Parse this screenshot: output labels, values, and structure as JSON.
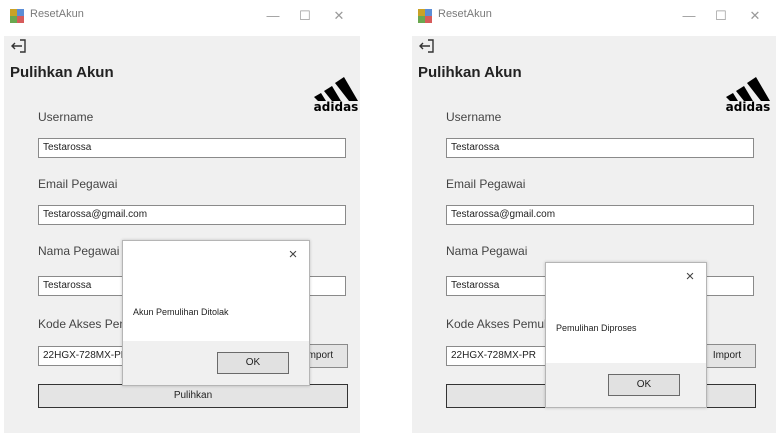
{
  "window_title": "ResetAkun",
  "window_controls": {
    "minimize": "—",
    "maximize": "☐",
    "close": "✕"
  },
  "form": {
    "heading": "Pulihkan Akun",
    "logo_text": "adidas",
    "username_label": "Username",
    "email_label": "Email Pegawai",
    "nama_label": "Nama Pegawai",
    "kode_label": "Kode Akses Pemulihan",
    "import_label": "Import",
    "pulihkan_label": "Pulihkan"
  },
  "left": {
    "username": "Testarossa",
    "email": "Testarossa@gmail.com",
    "nama": "Testarossa",
    "kode": "22HGX-728MX-PR"
  },
  "right": {
    "username": "Testarossa",
    "email": "Testarossa@gmail.com",
    "nama": "Testarossa",
    "kode": "22HGX-728MX-PR"
  },
  "dialog_left": {
    "message": "Akun Pemulihan Ditolak",
    "ok_label": "OK",
    "close_label": "×"
  },
  "dialog_right": {
    "message": "Pemulihan Diproses",
    "ok_label": "OK",
    "close_label": "×"
  },
  "colors": {
    "window_bg": "#f0f0f0",
    "dialog_footer": "#f0f0f0",
    "border": "#8a8a8a"
  }
}
